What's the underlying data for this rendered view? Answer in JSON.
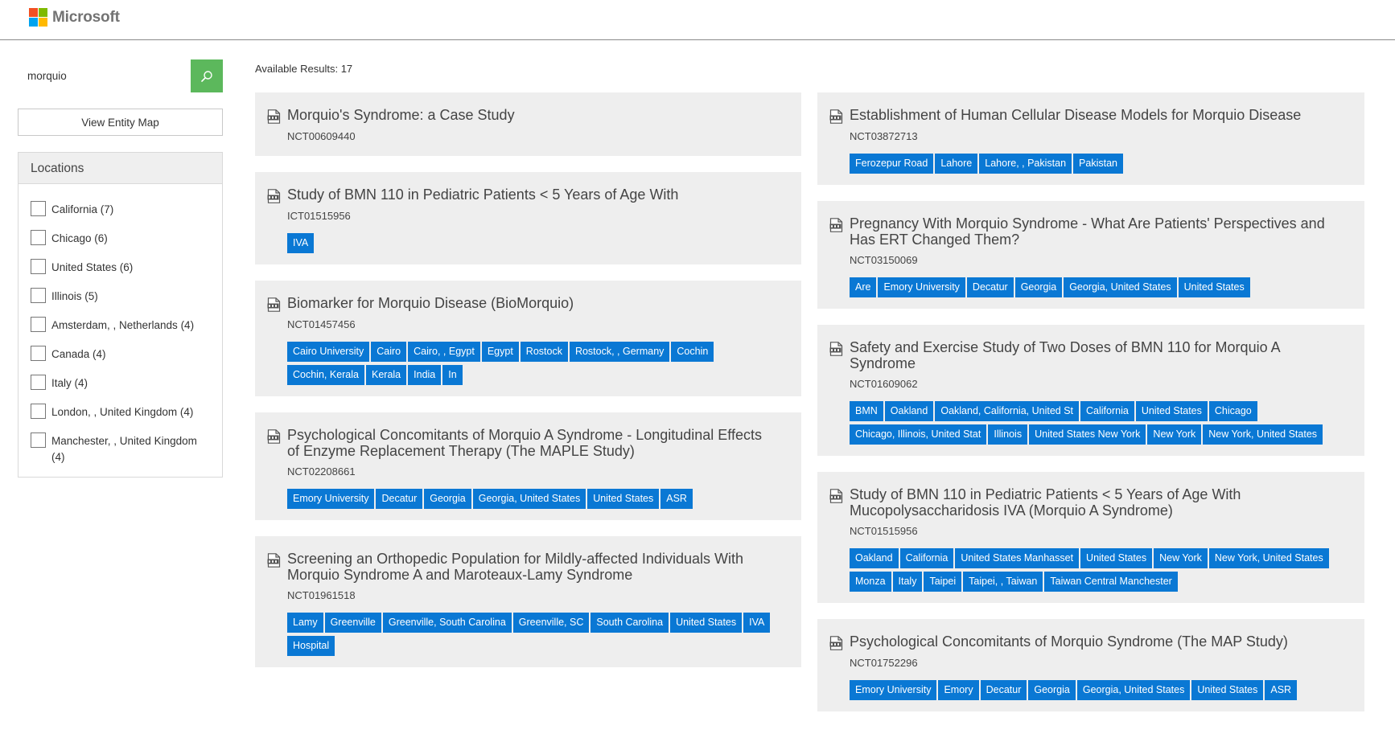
{
  "header": {
    "brand": "Microsoft",
    "logo_colors": [
      "#f25022",
      "#7fba00",
      "#00a4ef",
      "#ffb900"
    ]
  },
  "search": {
    "value": "morquio",
    "button_icon": "search-icon",
    "button_color": "#5cb85c"
  },
  "entity_map_label": "View Entity Map",
  "locations": {
    "title": "Locations",
    "items": [
      {
        "label": "California (7)"
      },
      {
        "label": "Chicago (6)"
      },
      {
        "label": "United States (6)"
      },
      {
        "label": "Illinois (5)"
      },
      {
        "label": "Amsterdam, , Netherlands (4)"
      },
      {
        "label": "Canada (4)"
      },
      {
        "label": "Italy (4)"
      },
      {
        "label": "London, , United Kingdom (4)"
      },
      {
        "label": "Manchester, , United Kingdom (4)"
      }
    ]
  },
  "results_label": "Available Results: 17",
  "tag_color": "#0a78d4",
  "results_left": [
    {
      "title": "Morquio's Syndrome: a Case Study",
      "id": "NCT00609440",
      "tags": []
    },
    {
      "title": "Study of BMN 110 in Pediatric Patients < 5 Years of Age With",
      "id": "ICT01515956",
      "tags": [
        "IVA"
      ]
    },
    {
      "title": "Biomarker for Morquio Disease (BioMorquio)",
      "id": "NCT01457456",
      "tags": [
        "Cairo University",
        "Cairo",
        "Cairo, , Egypt",
        "Egypt",
        "Rostock",
        "Rostock, , Germany",
        "Cochin",
        "Cochin, Kerala",
        "Kerala",
        "India",
        "In"
      ]
    },
    {
      "title": "Psychological Concomitants of Morquio A Syndrome - Longitudinal Effects of Enzyme Replacement Therapy (The MAPLE Study)",
      "id": "NCT02208661",
      "tags": [
        "Emory University",
        "Decatur",
        "Georgia",
        "Georgia, United States",
        "United States",
        "ASR"
      ]
    },
    {
      "title": "Screening an Orthopedic Population for Mildly-affected Individuals With Morquio Syndrome A and Maroteaux-Lamy Syndrome",
      "id": "NCT01961518",
      "tags": [
        "Lamy",
        "Greenville",
        "Greenville, South Carolina",
        "Greenville, SC",
        "South Carolina",
        "United States",
        "IVA",
        "Hospital"
      ]
    }
  ],
  "results_right": [
    {
      "title": "Establishment of Human Cellular Disease Models for Morquio Disease",
      "id": "NCT03872713",
      "tags": [
        "Ferozepur Road",
        "Lahore",
        "Lahore, , Pakistan",
        "Pakistan"
      ]
    },
    {
      "title": "Pregnancy With Morquio Syndrome - What Are Patients' Perspectives and Has ERT Changed Them?",
      "id": "NCT03150069",
      "tags": [
        "Are",
        "Emory University",
        "Decatur",
        "Georgia",
        "Georgia, United States",
        "United States"
      ]
    },
    {
      "title": "Safety and Exercise Study of Two Doses of BMN 110 for Morquio A Syndrome",
      "id": "NCT01609062",
      "tags": [
        "BMN",
        "Oakland",
        "Oakland, California, United St",
        "California",
        "United States",
        "Chicago",
        "Chicago, Illinois, United Stat",
        "Illinois",
        "United States New York",
        "New York",
        "New York, United States"
      ]
    },
    {
      "title": "Study of BMN 110 in Pediatric Patients < 5 Years of Age With Mucopolysaccharidosis IVA (Morquio A Syndrome)",
      "id": "NCT01515956",
      "tags": [
        "Oakland",
        "California",
        "United States Manhasset",
        "United States",
        "New York",
        "New York, United States",
        "Monza",
        "Italy",
        "Taipei",
        "Taipei, , Taiwan",
        "Taiwan Central Manchester"
      ]
    },
    {
      "title": "Psychological Concomitants of Morquio Syndrome (The MAP Study)",
      "id": "NCT01752296",
      "tags": [
        "Emory University",
        "Emory",
        "Decatur",
        "Georgia",
        "Georgia, United States",
        "United States",
        "ASR"
      ]
    }
  ]
}
